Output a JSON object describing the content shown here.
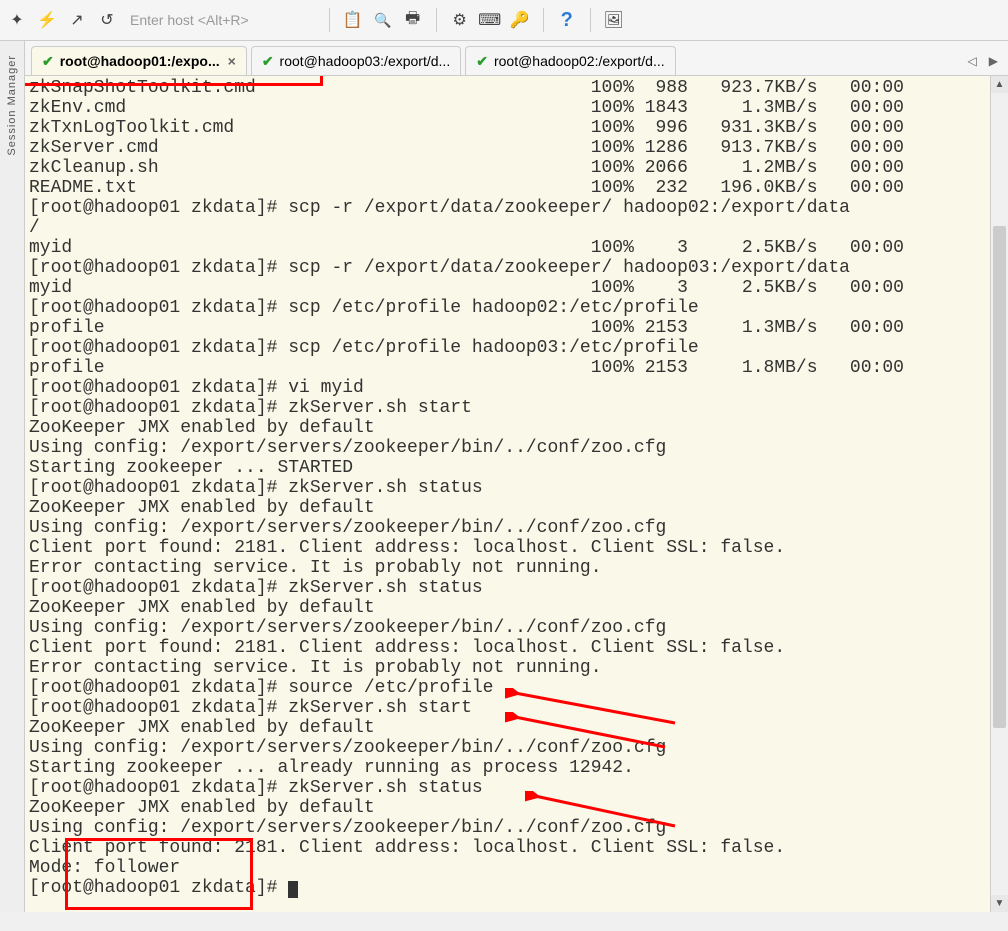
{
  "toolbar": {
    "hostplaceholder": "Enter host <Alt+R>"
  },
  "sidebar": {
    "label": "Session Manager"
  },
  "tabs": [
    {
      "label": "root@hadoop01:/expo...",
      "active": true
    },
    {
      "label": "root@hadoop03:/export/d...",
      "active": false
    },
    {
      "label": "root@hadoop02:/export/d...",
      "active": false
    }
  ],
  "terminal": {
    "lines": [
      "zkSnapShotToolkit.cmd                               100%  988   923.7KB/s   00:00",
      "zkEnv.cmd                                           100% 1843     1.3MB/s   00:00",
      "zkTxnLogToolkit.cmd                                 100%  996   931.3KB/s   00:00",
      "zkServer.cmd                                        100% 1286   913.7KB/s   00:00",
      "zkCleanup.sh                                        100% 2066     1.2MB/s   00:00",
      "README.txt                                          100%  232   196.0KB/s   00:00",
      "[root@hadoop01 zkdata]# scp -r /export/data/zookeeper/ hadoop02:/export/data",
      "/",
      "myid                                                100%    3     2.5KB/s   00:00",
      "[root@hadoop01 zkdata]# scp -r /export/data/zookeeper/ hadoop03:/export/data",
      "myid                                                100%    3     2.5KB/s   00:00",
      "[root@hadoop01 zkdata]# scp /etc/profile hadoop02:/etc/profile",
      "profile                                             100% 2153     1.3MB/s   00:00",
      "[root@hadoop01 zkdata]# scp /etc/profile hadoop03:/etc/profile",
      "profile                                             100% 2153     1.8MB/s   00:00",
      "[root@hadoop01 zkdata]# vi myid",
      "[root@hadoop01 zkdata]# zkServer.sh start",
      "ZooKeeper JMX enabled by default",
      "Using config: /export/servers/zookeeper/bin/../conf/zoo.cfg",
      "Starting zookeeper ... STARTED",
      "[root@hadoop01 zkdata]# zkServer.sh status",
      "ZooKeeper JMX enabled by default",
      "Using config: /export/servers/zookeeper/bin/../conf/zoo.cfg",
      "Client port found: 2181. Client address: localhost. Client SSL: false.",
      "Error contacting service. It is probably not running.",
      "[root@hadoop01 zkdata]# zkServer.sh status",
      "ZooKeeper JMX enabled by default",
      "Using config: /export/servers/zookeeper/bin/../conf/zoo.cfg",
      "Client port found: 2181. Client address: localhost. Client SSL: false.",
      "Error contacting service. It is probably not running.",
      "[root@hadoop01 zkdata]# source /etc/profile",
      "[root@hadoop01 zkdata]# zkServer.sh start",
      "ZooKeeper JMX enabled by default",
      "Using config: /export/servers/zookeeper/bin/../conf/zoo.cfg",
      "Starting zookeeper ... already running as process 12942.",
      "[root@hadoop01 zkdata]# zkServer.sh status",
      "ZooKeeper JMX enabled by default",
      "Using config: /export/servers/zookeeper/bin/../conf/zoo.cfg",
      "Client port found: 2181. Client address: localhost. Client SSL: false.",
      "Mode: follower",
      "[root@hadoop01 zkdata]# "
    ]
  }
}
